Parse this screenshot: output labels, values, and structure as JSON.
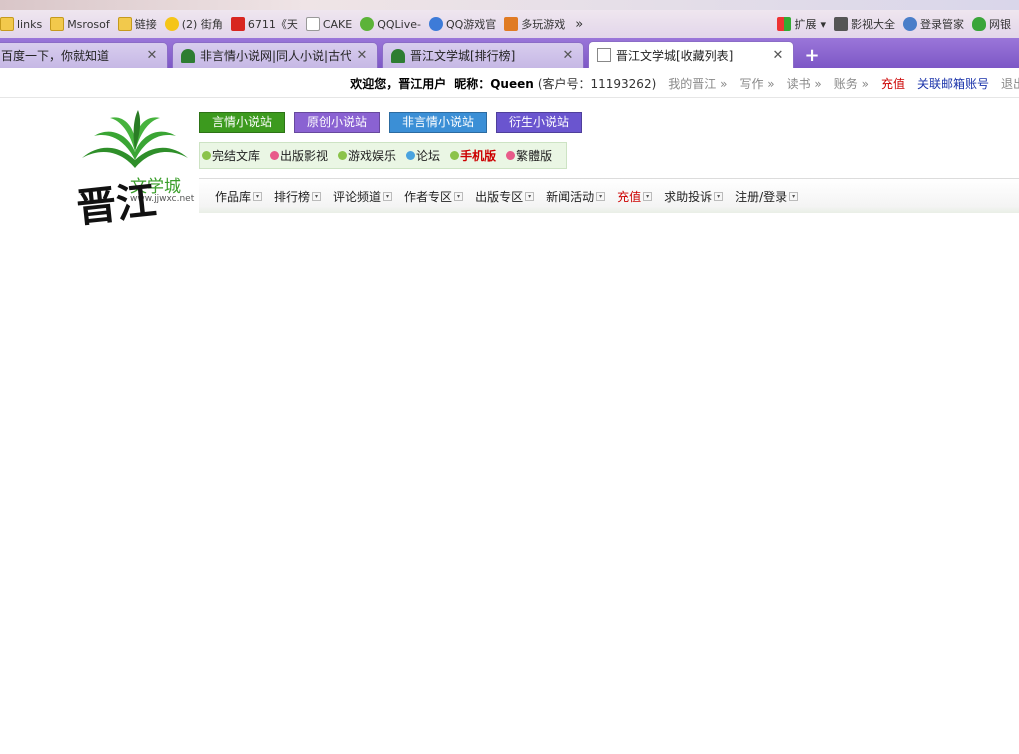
{
  "bookmarks": {
    "items": [
      {
        "label": "links",
        "icon": "folder-icon"
      },
      {
        "label": "Msrosof",
        "icon": "folder-icon"
      },
      {
        "label": "链接",
        "icon": "folder-icon"
      },
      {
        "label": "(2) 街角",
        "icon": "star-icon"
      },
      {
        "label": "6711《天",
        "icon": "tian-icon"
      },
      {
        "label": "CAKE",
        "icon": "page-icon"
      },
      {
        "label": "QQLive-",
        "icon": "qqlive-icon"
      },
      {
        "label": "QQ游戏官",
        "icon": "qqgame-icon"
      },
      {
        "label": "多玩游戏",
        "icon": "duowan-icon"
      }
    ],
    "more": "»",
    "right_items": [
      {
        "label": "扩展",
        "icon": "extension-icon",
        "caret": "▾"
      },
      {
        "label": "影视大全",
        "icon": "film-icon"
      },
      {
        "label": "登录管家",
        "icon": "login-icon"
      },
      {
        "label": "网银",
        "icon": "shield-icon"
      }
    ]
  },
  "tabs": [
    {
      "label": "百度一下，你就知道",
      "close": "✕",
      "active": false
    },
    {
      "label": "非言情小说网|同人小说|古代",
      "close": "✕",
      "active": false
    },
    {
      "label": "晋江文学城[排行榜]",
      "close": "✕",
      "active": false
    },
    {
      "label": "晋江文学城[收藏列表]",
      "close": "✕",
      "active": true
    }
  ],
  "new_tab": "+",
  "userbar": {
    "welcome": "欢迎您，晋江用户",
    "nickname": "昵称：Queen",
    "client_id": "(客户号：11193262)",
    "my_jinjiang": "我的晋江 »",
    "write": "写作 »",
    "read": "读书 »",
    "account": "账务 »",
    "recharge": "充值",
    "link_email": "关联邮箱账号",
    "logout": "退出"
  },
  "logo": {
    "brand_small": "文学城",
    "brand_url": "www.jjwxc.net",
    "brand_big": "晋江"
  },
  "site_buttons": [
    {
      "label": "言情小说站",
      "color": "#3c9a1e"
    },
    {
      "label": "原创小说站",
      "color": "#8a62d2"
    },
    {
      "label": "非言情小说站",
      "color": "#3b8fd6"
    },
    {
      "label": "衍生小说站",
      "color": "#6a55cf"
    }
  ],
  "quick_links": [
    {
      "label": "完结文库",
      "dot": "#8bc34a"
    },
    {
      "label": "出版影视",
      "dot": "#e85b8a"
    },
    {
      "label": "游戏娱乐",
      "dot": "#8bc34a"
    },
    {
      "label": "论坛",
      "dot": "#4aa3df"
    },
    {
      "label": "手机版",
      "dot": "#8bc34a",
      "highlight": true
    },
    {
      "label": "繁體版",
      "dot": "#e85b8a"
    }
  ],
  "main_nav": [
    {
      "label": "作品库",
      "red": false
    },
    {
      "label": "排行榜",
      "red": false
    },
    {
      "label": "评论频道",
      "red": false
    },
    {
      "label": "作者专区",
      "red": false
    },
    {
      "label": "出版专区",
      "red": false
    },
    {
      "label": "新闻活动",
      "red": false
    },
    {
      "label": "充值",
      "red": true
    },
    {
      "label": "求助投诉",
      "red": false
    },
    {
      "label": "注册/登录",
      "red": false
    }
  ],
  "nav_caret": "▾"
}
